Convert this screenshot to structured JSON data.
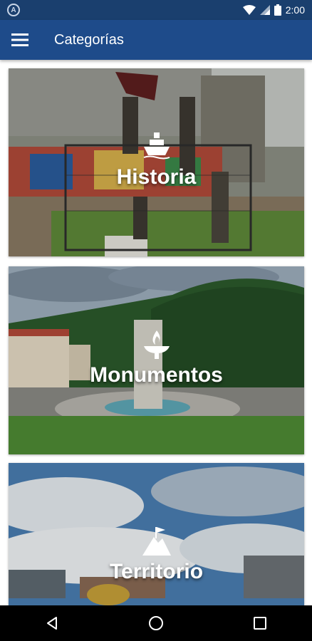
{
  "status_bar": {
    "app_icon_letter": "A",
    "time": "2:00",
    "icons": [
      "wifi-icon",
      "signal-icon",
      "battery-icon"
    ]
  },
  "app_bar": {
    "title": "Categorías",
    "menu_icon": "hamburger-menu-icon",
    "background": "#1e4b8a"
  },
  "categories": [
    {
      "label": "Historia",
      "icon": "ship-icon"
    },
    {
      "label": "Monumentos",
      "icon": "torch-icon"
    },
    {
      "label": "Territorio",
      "icon": "mountain-flag-icon"
    }
  ],
  "nav_bar": {
    "buttons": [
      "back-icon",
      "home-icon",
      "recents-icon"
    ]
  }
}
